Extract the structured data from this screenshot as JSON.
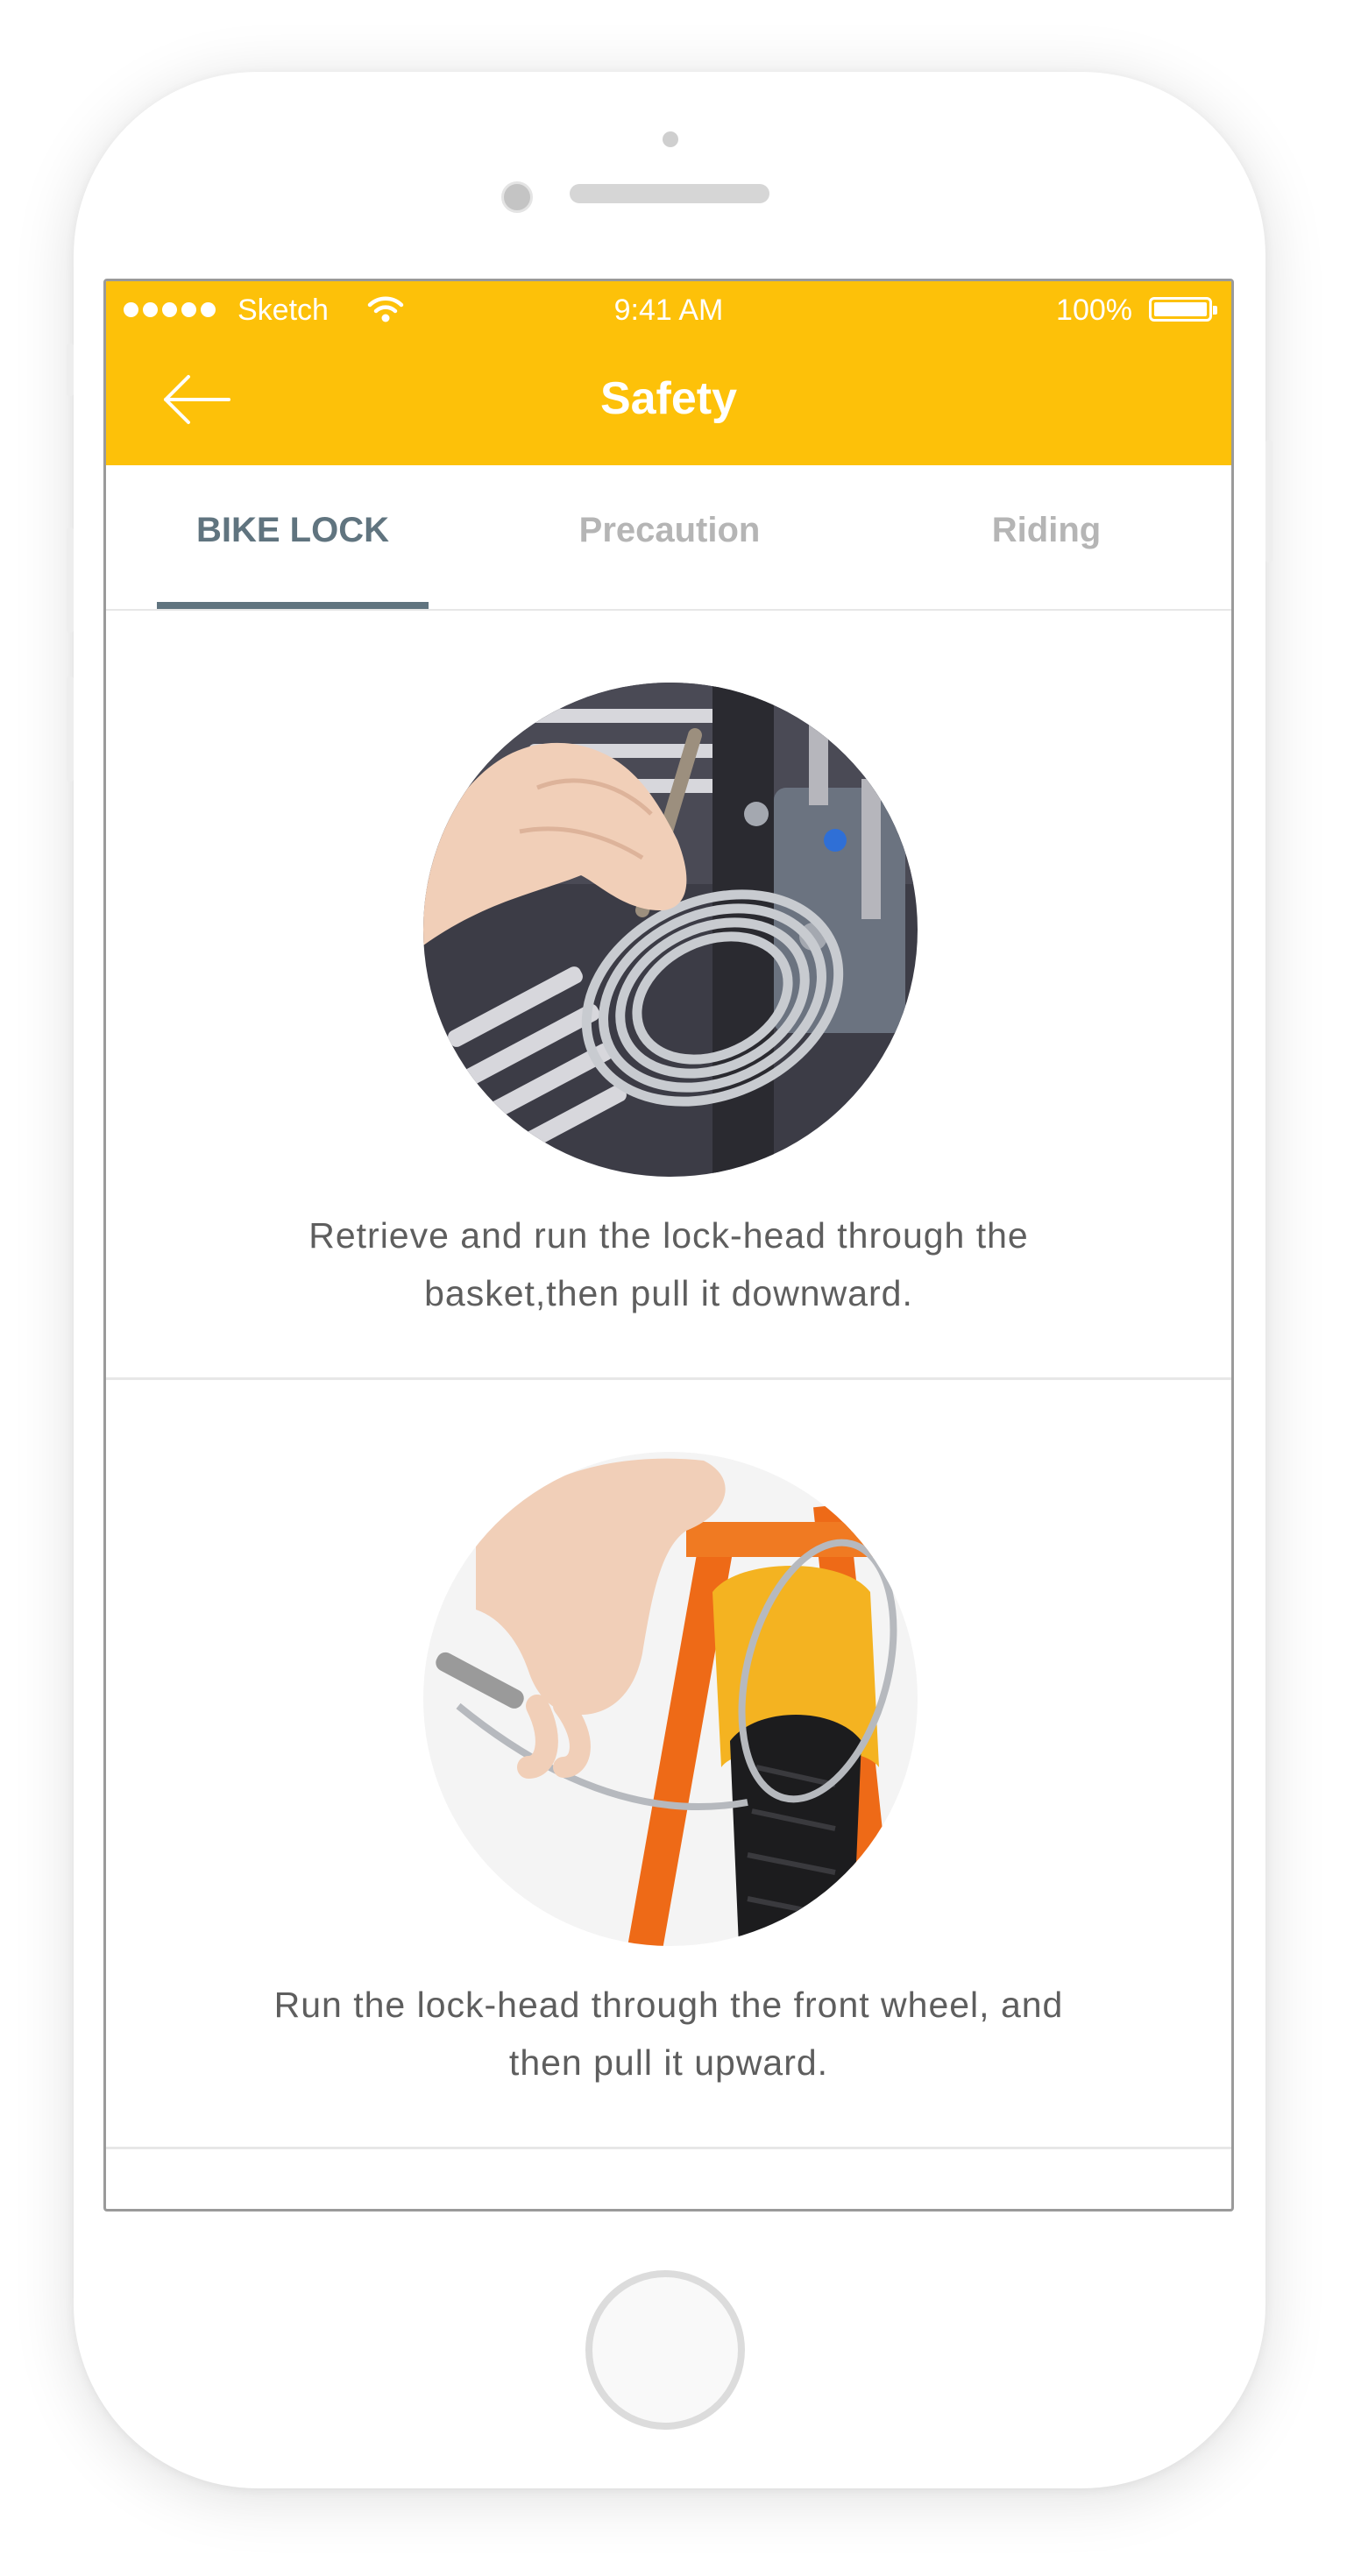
{
  "status_bar": {
    "carrier": "Sketch",
    "time": "9:41 AM",
    "battery_percent": "100%",
    "battery_level": 1.0
  },
  "nav": {
    "title": "Safety",
    "back_icon": "arrow-left-icon",
    "bar_color": "#FDC109"
  },
  "tabs": [
    {
      "label": "BIKE LOCK",
      "active": true
    },
    {
      "label": "Precaution",
      "active": false
    },
    {
      "label": "Riding",
      "active": false
    }
  ],
  "steps": [
    {
      "image": "lock-cable-basket-photo",
      "caption_line1": "Retrieve and run the lock-head through the",
      "caption_line2": "basket,then pull it downward."
    },
    {
      "image": "lock-cable-front-wheel-photo",
      "caption_line1": "Run the lock-head through the front wheel, and",
      "caption_line2": "then pull it upward."
    }
  ],
  "colors": {
    "tab_active": "#60747f",
    "tab_inactive": "#b5b5b5",
    "caption": "#5e5e5e"
  }
}
